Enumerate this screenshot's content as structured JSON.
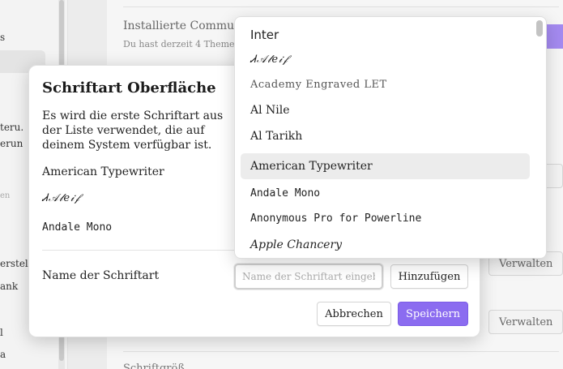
{
  "background": {
    "sidebar_items": [
      "s",
      "teru.",
      "erun",
      "en",
      "erstell",
      "ank",
      "l",
      "a"
    ],
    "community_heading": "Installierte Commu",
    "community_sub": "Du hast derzeit 4 Theme",
    "manage_label": "Verwalten",
    "bottom_heading": "Schriftgröß"
  },
  "dialog": {
    "title": "Schriftart Oberfläche",
    "description": "Es wird die erste Schriftart aus der Liste verwendet, die auf deinem System verfügbar ist.",
    "fonts": [
      "American Typewriter",
      "Ꮧ𝒜𝓁𝑒𝒾𝒻",
      "Andale Mono"
    ],
    "name_label": "Name der Schriftart",
    "name_placeholder": "Name der Schriftart eingeben",
    "add_label": "Hinzufügen",
    "cancel_label": "Abbrechen",
    "save_label": "Speichern"
  },
  "dropdown": {
    "options": [
      "Inter",
      "Ꮧ𝒜𝓁𝑒𝒾𝒻",
      "Academy Engraved LET",
      "Al Nile",
      "Al Tarikh",
      "American Typewriter",
      "Andale Mono",
      "Anonymous Pro for Powerline",
      "Apple Chancery"
    ],
    "highlighted": "American Typewriter"
  },
  "colors": {
    "accent": "#8b6cf0",
    "accent_border": "#7a5be6",
    "highlight": "#ececec"
  }
}
